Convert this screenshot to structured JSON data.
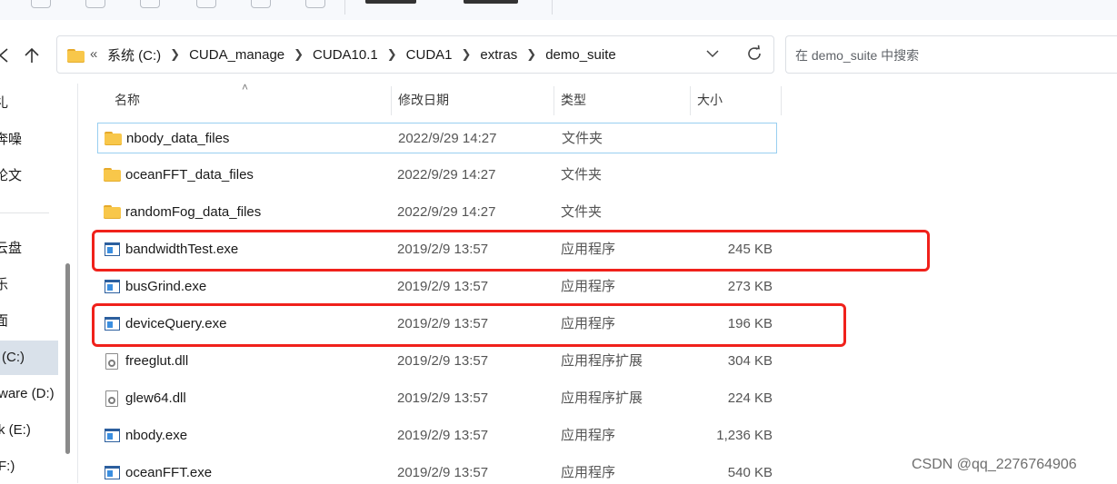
{
  "address_bar": {
    "overflow_glyph": "«",
    "breadcrumbs": [
      "系统 (C:)",
      "CUDA_manage",
      "CUDA10.1",
      "CUDA1",
      "extras",
      "demo_suite"
    ]
  },
  "search": {
    "placeholder": "在 demo_suite 中搜索"
  },
  "nav_pane": {
    "items": [
      "礼",
      "奔噪",
      "论文",
      "云盘",
      "乐",
      "面",
      "(C:)",
      "ware (D:)",
      "k (E:)",
      "F:)"
    ],
    "selected": "(C:)"
  },
  "columns": {
    "name": "名称",
    "date": "修改日期",
    "type": "类型",
    "size": "大小"
  },
  "files": [
    {
      "name": "nbody_data_files",
      "date": "2022/9/29 14:27",
      "type": "文件夹",
      "size": "",
      "icon": "folder-icon"
    },
    {
      "name": "oceanFFT_data_files",
      "date": "2022/9/29 14:27",
      "type": "文件夹",
      "size": "",
      "icon": "folder-icon"
    },
    {
      "name": "randomFog_data_files",
      "date": "2022/9/29 14:27",
      "type": "文件夹",
      "size": "",
      "icon": "folder-icon"
    },
    {
      "name": "bandwidthTest.exe",
      "date": "2019/2/9 13:57",
      "type": "应用程序",
      "size": "245 KB",
      "icon": "exe-icon"
    },
    {
      "name": "busGrind.exe",
      "date": "2019/2/9 13:57",
      "type": "应用程序",
      "size": "273 KB",
      "icon": "exe-icon"
    },
    {
      "name": "deviceQuery.exe",
      "date": "2019/2/9 13:57",
      "type": "应用程序",
      "size": "196 KB",
      "icon": "exe-icon"
    },
    {
      "name": "freeglut.dll",
      "date": "2019/2/9 13:57",
      "type": "应用程序扩展",
      "size": "304 KB",
      "icon": "dll-icon"
    },
    {
      "name": "glew64.dll",
      "date": "2019/2/9 13:57",
      "type": "应用程序扩展",
      "size": "224 KB",
      "icon": "dll-icon"
    },
    {
      "name": "nbody.exe",
      "date": "2019/2/9 13:57",
      "type": "应用程序",
      "size": "1,236 KB",
      "icon": "exe-icon"
    },
    {
      "name": "oceanFFT.exe",
      "date": "2019/2/9 13:57",
      "type": "应用程序",
      "size": "540 KB",
      "icon": "exe-icon"
    }
  ],
  "highlight_color": "#f0211b",
  "watermark": "CSDN @qq_2276764906"
}
